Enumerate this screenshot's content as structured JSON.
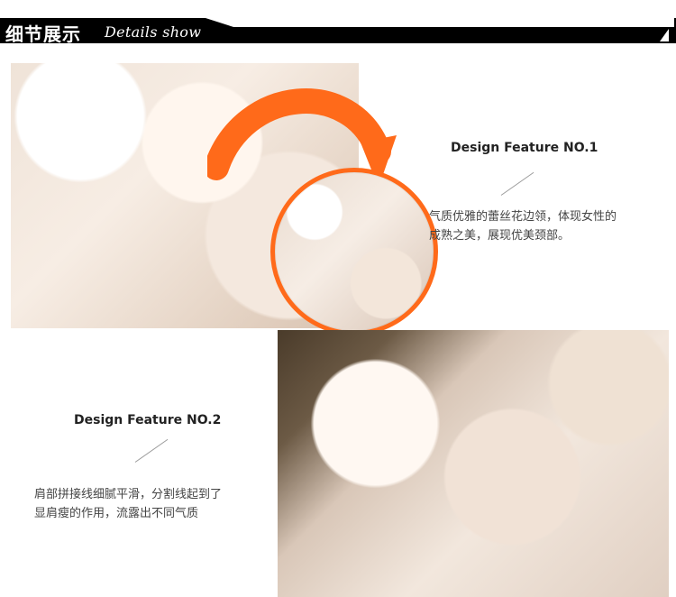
{
  "header": {
    "title_cn": "细节展示",
    "title_en": "Details show"
  },
  "features": [
    {
      "title": "Design Feature NO.1",
      "desc_line1": "气质优雅的蕾丝花边领，体现女性的",
      "desc_line2": "成熟之美，展现优美颈部。"
    },
    {
      "title": "Design Feature NO.2",
      "desc_line1": "肩部拼接线细腻平滑，分割线起到了",
      "desc_line2": "显肩瘦的作用，流露出不同气质"
    }
  ],
  "colors": {
    "accent": "#ff6a1a",
    "header_bg": "#000000",
    "header_text": "#ffffff",
    "text": "#444444"
  },
  "icons": {
    "arrow": "curved-arrow-icon",
    "zoom": "detail-zoom-circle"
  }
}
